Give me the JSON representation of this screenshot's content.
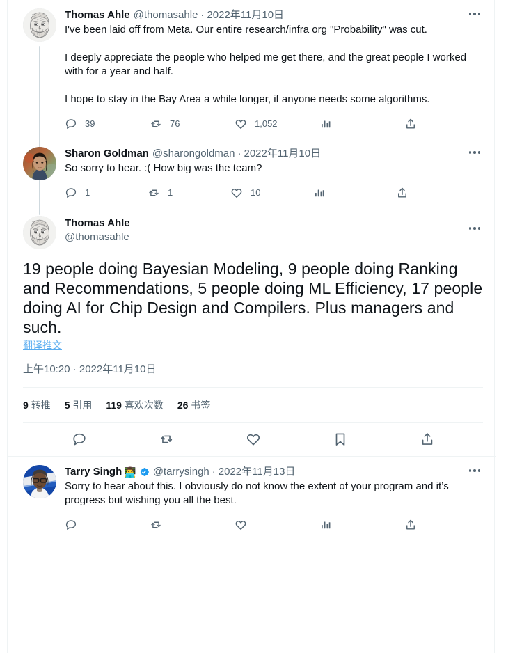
{
  "thread": {
    "tweets": [
      {
        "id": "tweet-thomas-first",
        "author_name": "Thomas Ahle",
        "handle": "@thomasahle",
        "separator": "·",
        "date": "2022年11月10日",
        "text": "I've been laid off from Meta. Our entire research/infra org \"Probability\" was cut.\n\nI deeply appreciate the people who helped me get there, and the great people I worked with for a year and half.\n\nI hope to stay in the Bay Area a while longer, if anyone needs some algorithms.",
        "actions": {
          "reply_count": "39",
          "retweet_count": "76",
          "like_count": "1,052",
          "views_count": "",
          "share_count": ""
        }
      },
      {
        "id": "tweet-sharon",
        "author_name": "Sharon Goldman",
        "handle": "@sharongoldman",
        "separator": "·",
        "date": "2022年11月10日",
        "text": "So sorry to hear. :( How big was the team?",
        "actions": {
          "reply_count": "1",
          "retweet_count": "1",
          "like_count": "10",
          "views_count": "",
          "share_count": ""
        }
      },
      {
        "id": "tweet-tarry",
        "author_name": "Tarry Singh",
        "name_emoji": "👨‍💻",
        "verified": true,
        "handle": "@tarrysingh",
        "separator": "·",
        "date": "2022年11月13日",
        "text": "Sorry to hear about this. I obviously do not know the extent of your program and it’s progress but wishing you all the best.",
        "actions": {
          "reply_count": "",
          "retweet_count": "",
          "like_count": "",
          "views_count": "",
          "share_count": ""
        }
      }
    ]
  },
  "focus_tweet": {
    "author_name": "Thomas Ahle",
    "handle": "@thomasahle",
    "text": "19 people doing Bayesian Modeling, 9 people doing Ranking and Recommendations, 5 people doing ML Efficiency, 17 people doing AI for Chip Design and Compilers. Plus managers and such.",
    "translate_label": "翻译推文",
    "timestamp": "上午10:20 · 2022年11月10日",
    "stats": [
      {
        "value": "9",
        "label": "转推"
      },
      {
        "value": "5",
        "label": "引用"
      },
      {
        "value": "119",
        "label": "喜欢次数"
      },
      {
        "value": "26",
        "label": "书签"
      }
    ],
    "action_names": {
      "reply": "reply",
      "retweet": "retweet",
      "like": "like",
      "bookmark": "bookmark",
      "share": "share"
    }
  },
  "colors": {
    "accent": "#1d9bf0",
    "link": "#5badf0",
    "muted": "#536471",
    "text": "#0f1419",
    "divider": "#eff3f4",
    "thread_line": "#cfd9de"
  }
}
